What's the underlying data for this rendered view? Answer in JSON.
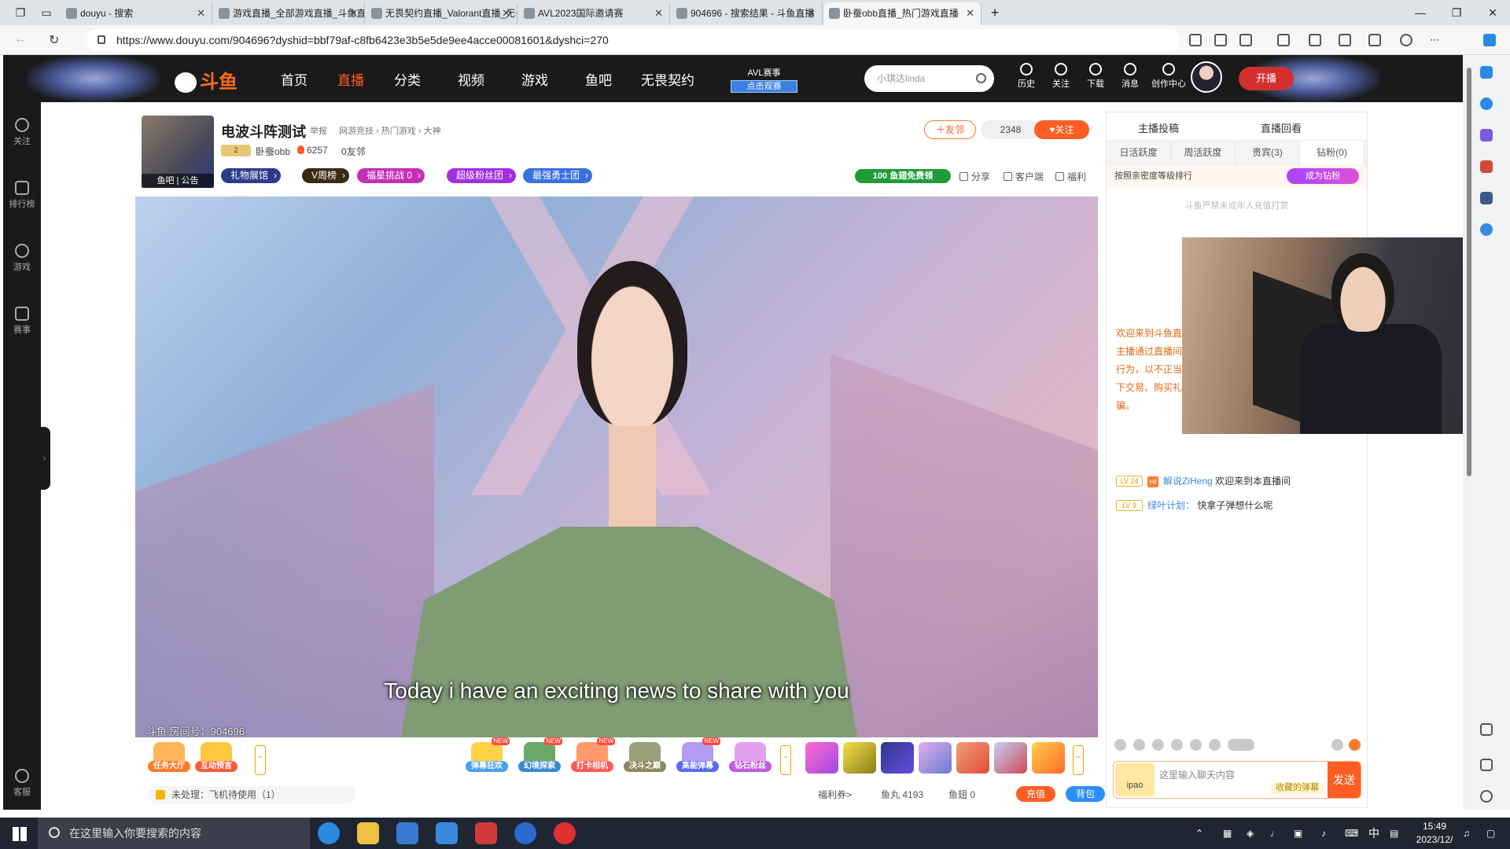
{
  "browser": {
    "tabs": [
      {
        "title": "douyu - 搜索"
      },
      {
        "title": "游戏直播_全部游戏直播_斗鱼直播"
      },
      {
        "title": "无畏契约直播_Valorant直播_无畏"
      },
      {
        "title": "AVL2023国际邀请赛"
      },
      {
        "title": "904696 - 搜索结果 - 斗鱼直播"
      },
      {
        "title": "卧蚕obb直播_热门游戏直播"
      }
    ],
    "url": "https://www.douyu.com/904696?dyshid=bbf79af-c8fb6423e3b5e5de9ee4acce00081601&dyshci=270"
  },
  "header": {
    "logo": "斗鱼",
    "nav": [
      "首页",
      "直播",
      "分类",
      "视频",
      "游戏",
      "鱼吧",
      "无畏契约"
    ],
    "active_nav": "直播",
    "avl_title": "AVL赛事",
    "avl_cta": "点击观赛",
    "search_placeholder": "小琪达linda",
    "icons": [
      {
        "label": "历史",
        "icon": "clock-icon"
      },
      {
        "label": "关注",
        "icon": "heart-icon"
      },
      {
        "label": "下载",
        "icon": "download-icon"
      },
      {
        "label": "消息",
        "icon": "bell-icon"
      },
      {
        "label": "创作中心",
        "icon": "bulb-icon"
      }
    ],
    "live_button": "开播"
  },
  "rail": {
    "items": [
      "关注",
      "排行榜",
      "游戏",
      "赛事"
    ],
    "bottom": "客服"
  },
  "room": {
    "cover_tags": "鱼吧 | 公告",
    "title": "电波斗阵测试",
    "report": "举报",
    "breadcrumb": "网游竞技 › 热门游戏 › 大神",
    "level": "2",
    "streamer": "卧蚕obb",
    "heat": "6257",
    "friends": "0友邻",
    "pills": [
      {
        "label": "礼物展馆",
        "color": "#2c3c8c"
      },
      {
        "label": "V周榜",
        "color": "#3a2a12"
      },
      {
        "label": "福星挑战 0",
        "color": "#c42fb7"
      },
      {
        "label": "超级粉丝团",
        "color": "#a12fe0"
      },
      {
        "label": "最强勇士团",
        "color": "#3b70e0"
      }
    ],
    "friend_button": "友邻",
    "fans_count": "2348",
    "follow_button": "关注",
    "promo": "100 鱼翅免费领",
    "tools": [
      "分享",
      "客户端",
      "福利"
    ]
  },
  "video": {
    "subtitle": "Today i have an exciting news to share with you",
    "room_number": "斗鱼 房间号：904696"
  },
  "gifts": {
    "left": [
      {
        "label": "任务大厅",
        "color": "#ff7a2d"
      },
      {
        "label": "互动预言",
        "color": "#ff5a3a"
      }
    ],
    "center": [
      {
        "label": "弹幕狂欢",
        "color": "#4aa0f0",
        "new": "NEW"
      },
      {
        "label": "幻境探索",
        "color": "#3a8ad0",
        "new": "NEW"
      },
      {
        "label": "打卡相机",
        "color": "#ff5a5a",
        "new": "NEW"
      },
      {
        "label": "决斗之巅",
        "color": "#8a8a5a",
        "new": ""
      },
      {
        "label": "高能弹幕",
        "color": "#5a6af0",
        "new": "NEW"
      },
      {
        "label": "钻石粉丝",
        "color": "#c05ae0",
        "new": ""
      }
    ],
    "pending": "未处理：飞机待使用（1）",
    "welfare": "福利券>",
    "fish_balls_label": "鱼丸",
    "fish_balls": "4193",
    "fish_fins_label": "鱼翅",
    "fish_fins": "0",
    "recharge": "充值",
    "backpack": "背包"
  },
  "chat": {
    "top_left": "主播投稿",
    "top_right": "直播回看",
    "tabs": [
      "日活跃度",
      "周活跃度",
      "贵宾(3)",
      "钻粉(0)"
    ],
    "rank_label": "按照亲密度等级排行",
    "become_diamond": "成为钻粉",
    "rank_empty": "斗鱼严禁未成年人充值打赏",
    "notice": "欢迎来到斗鱼直播！斗鱼严禁未成年人直播或打赏，严禁主播通过直播间传播封建迷信等不良信息，任何违法违规行为，以不正当方式以防人身财产受损失，请勿代拍、私下交易、购买礼包码、游戏币等广告信息，谨防网络诈骗。",
    "messages": [
      {
        "level": "LV 24",
        "hi": "HI",
        "user": "解说ZiHeng",
        "text": "欢迎来到本直播间"
      },
      {
        "level": "LV 9",
        "hi": "",
        "user": "绿叶计划：",
        "text": "快拿子弹想什么呢"
      }
    ],
    "input_placeholder": "这里输入聊天内容",
    "collect": "收藏的弹幕",
    "send": "发送",
    "ipao": "ipao"
  },
  "taskbar": {
    "search_placeholder": "在这里输入你要搜索的内容",
    "ime": "中",
    "time": "15:49",
    "date": "2023/12/"
  }
}
